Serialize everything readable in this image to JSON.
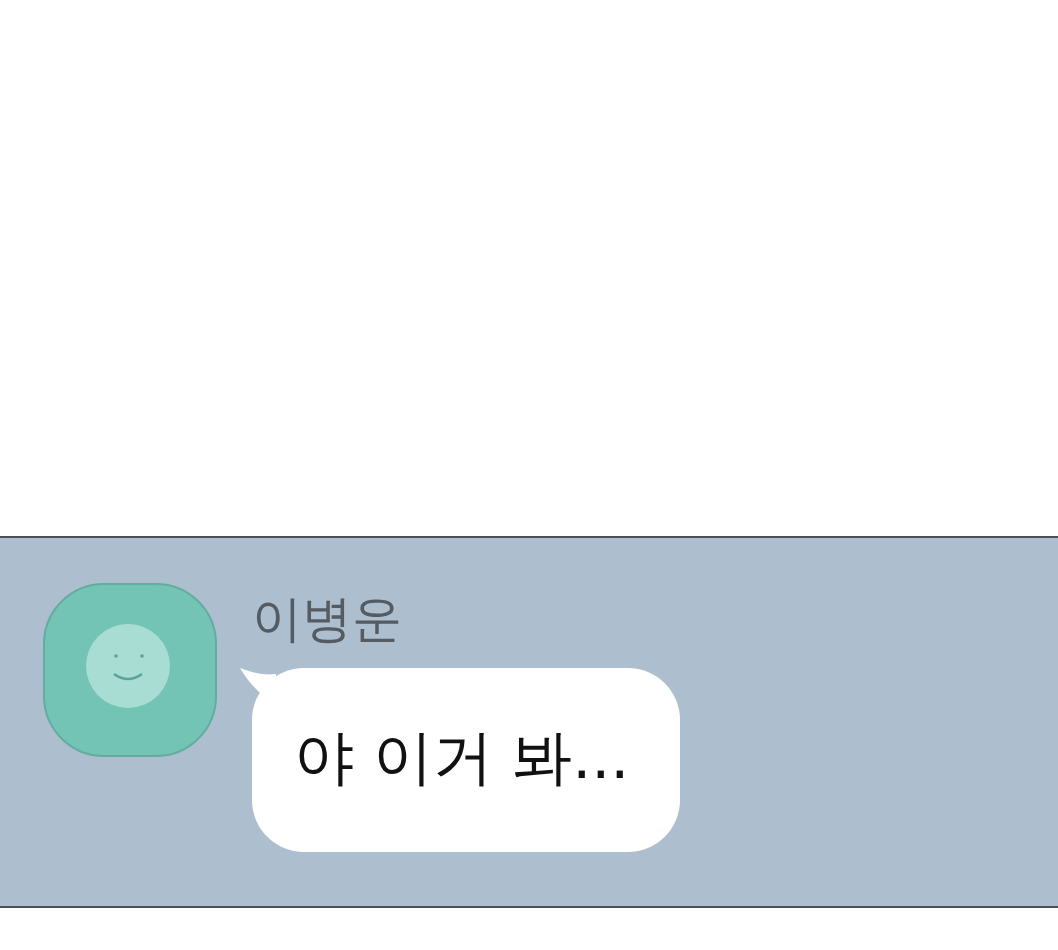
{
  "messages": [
    {
      "sender": "이병운",
      "text": "야 이거 봐..."
    }
  ]
}
